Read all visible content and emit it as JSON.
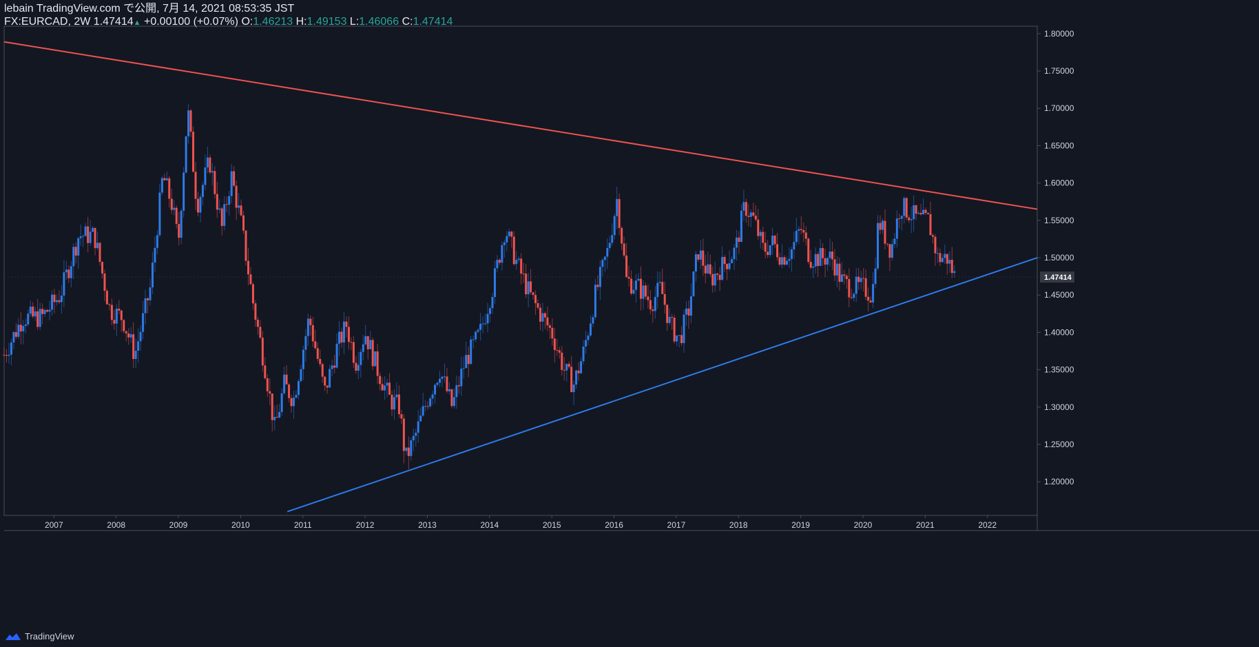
{
  "header": {
    "line1": "lebain TradingView.com で公開, 7月 14, 2021 08:53:35 JST",
    "symbol": "FX:EURCAD, 2W",
    "last": "1.47414",
    "change": "+0.00100 (+0.07%)",
    "o_label": "O:",
    "o": "1.46213",
    "h_label": "H:",
    "h": "1.49153",
    "l_label": "L:",
    "l": "1.46066",
    "c_label": "C:",
    "c": "1.47414"
  },
  "footer": {
    "brand": "TradingView"
  },
  "colors": {
    "background": "#131722",
    "up": "#2d7be8",
    "down": "#ef5350",
    "resistance": "#ef5350",
    "support": "#2d7be8",
    "axis": "#4a4e5a"
  },
  "chart_data": {
    "type": "candlestick",
    "ylim": [
      1.155,
      1.81
    ],
    "xlim": [
      2006.2,
      2022.8
    ],
    "y_ticks": [
      "1.80000",
      "1.75000",
      "1.70000",
      "1.65000",
      "1.60000",
      "1.55000",
      "1.50000",
      "1.45000",
      "1.40000",
      "1.35000",
      "1.30000",
      "1.25000",
      "1.20000"
    ],
    "x_ticks": [
      "2007",
      "2008",
      "2009",
      "2010",
      "2011",
      "2012",
      "2013",
      "2014",
      "2015",
      "2016",
      "2017",
      "2018",
      "2019",
      "2020",
      "2021",
      "2022"
    ],
    "last_price_label": "1.47414",
    "last_price": 1.47414,
    "resistance_line": {
      "start": [
        2006.2,
        1.789
      ],
      "end": [
        2022.8,
        1.565
      ]
    },
    "support_line": {
      "start": [
        2010.75,
        1.16
      ],
      "end": [
        2022.8,
        1.5
      ]
    },
    "price_path": [
      [
        2006.2,
        1.37
      ],
      [
        2006.5,
        1.42
      ],
      [
        2006.8,
        1.42
      ],
      [
        2007.1,
        1.45
      ],
      [
        2007.4,
        1.53
      ],
      [
        2007.65,
        1.53
      ],
      [
        2007.9,
        1.43
      ],
      [
        2008.1,
        1.42
      ],
      [
        2008.3,
        1.37
      ],
      [
        2008.55,
        1.46
      ],
      [
        2008.75,
        1.61
      ],
      [
        2008.9,
        1.57
      ],
      [
        2009.0,
        1.52
      ],
      [
        2009.15,
        1.7
      ],
      [
        2009.3,
        1.57
      ],
      [
        2009.5,
        1.63
      ],
      [
        2009.7,
        1.54
      ],
      [
        2009.85,
        1.61
      ],
      [
        2010.0,
        1.55
      ],
      [
        2010.2,
        1.44
      ],
      [
        2010.4,
        1.35
      ],
      [
        2010.55,
        1.27
      ],
      [
        2010.7,
        1.33
      ],
      [
        2010.85,
        1.31
      ],
      [
        2011.1,
        1.42
      ],
      [
        2011.35,
        1.32
      ],
      [
        2011.55,
        1.38
      ],
      [
        2011.7,
        1.41
      ],
      [
        2011.85,
        1.36
      ],
      [
        2012.0,
        1.4
      ],
      [
        2012.2,
        1.35
      ],
      [
        2012.4,
        1.31
      ],
      [
        2012.55,
        1.3
      ],
      [
        2012.65,
        1.23
      ],
      [
        2012.8,
        1.26
      ],
      [
        2013.0,
        1.31
      ],
      [
        2013.2,
        1.35
      ],
      [
        2013.4,
        1.3
      ],
      [
        2013.6,
        1.36
      ],
      [
        2013.85,
        1.4
      ],
      [
        2014.05,
        1.46
      ],
      [
        2014.25,
        1.54
      ],
      [
        2014.45,
        1.49
      ],
      [
        2014.65,
        1.45
      ],
      [
        2014.85,
        1.42
      ],
      [
        2015.0,
        1.4
      ],
      [
        2015.2,
        1.35
      ],
      [
        2015.35,
        1.33
      ],
      [
        2015.5,
        1.37
      ],
      [
        2015.7,
        1.45
      ],
      [
        2015.9,
        1.51
      ],
      [
        2016.05,
        1.58
      ],
      [
        2016.2,
        1.47
      ],
      [
        2016.4,
        1.46
      ],
      [
        2016.6,
        1.44
      ],
      [
        2016.75,
        1.46
      ],
      [
        2016.9,
        1.41
      ],
      [
        2017.05,
        1.39
      ],
      [
        2017.2,
        1.43
      ],
      [
        2017.35,
        1.51
      ],
      [
        2017.55,
        1.47
      ],
      [
        2017.75,
        1.49
      ],
      [
        2017.95,
        1.51
      ],
      [
        2018.1,
        1.57
      ],
      [
        2018.25,
        1.55
      ],
      [
        2018.4,
        1.51
      ],
      [
        2018.55,
        1.52
      ],
      [
        2018.7,
        1.5
      ],
      [
        2018.85,
        1.51
      ],
      [
        2019.0,
        1.54
      ],
      [
        2019.15,
        1.5
      ],
      [
        2019.35,
        1.5
      ],
      [
        2019.5,
        1.5
      ],
      [
        2019.65,
        1.47
      ],
      [
        2019.8,
        1.46
      ],
      [
        2020.0,
        1.46
      ],
      [
        2020.15,
        1.45
      ],
      [
        2020.25,
        1.55
      ],
      [
        2020.45,
        1.51
      ],
      [
        2020.6,
        1.57
      ],
      [
        2020.75,
        1.56
      ],
      [
        2020.9,
        1.55
      ],
      [
        2021.05,
        1.55
      ],
      [
        2021.2,
        1.5
      ],
      [
        2021.35,
        1.5
      ],
      [
        2021.5,
        1.47
      ]
    ]
  }
}
